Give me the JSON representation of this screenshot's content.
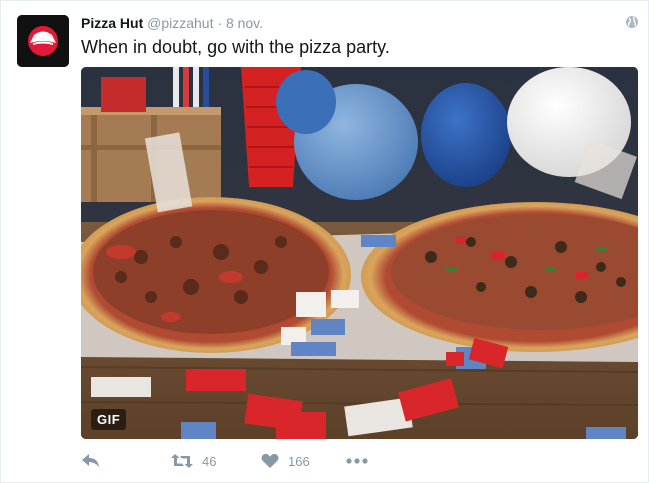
{
  "tweet": {
    "display_name": "Pizza Hut",
    "handle": "@pizzahut",
    "separator": "·",
    "date": "8 nov.",
    "text": "When in doubt, go with the pizza party.",
    "media_badge": "GIF"
  },
  "actions": {
    "reply_icon": "reply-icon",
    "retweet_icon": "retweet-icon",
    "retweet_count": "46",
    "like_icon": "heart-icon",
    "like_count": "166",
    "more_icon": "more-icon"
  },
  "colors": {
    "action_gray": "#8899a6",
    "brand_red": "#e31837",
    "name_text": "#14171a"
  }
}
